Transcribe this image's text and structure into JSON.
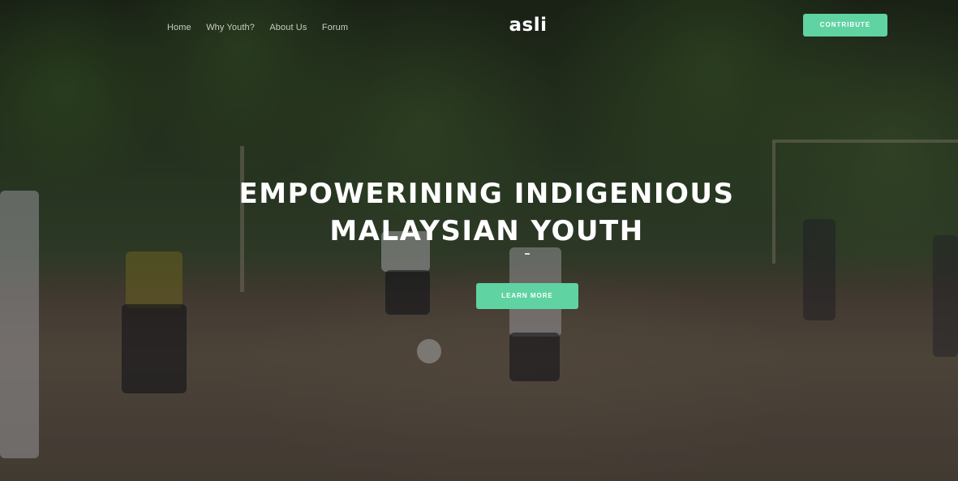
{
  "nav": {
    "items": [
      {
        "label": "Home"
      },
      {
        "label": "Why Youth?"
      },
      {
        "label": "About Us"
      },
      {
        "label": "Forum"
      }
    ]
  },
  "brand": {
    "logo_text": "asli"
  },
  "header": {
    "contribute_label": "CONTRIBUTE"
  },
  "hero": {
    "headline_line1": "EMPOWERINING INDIGENIOUS",
    "headline_line2": "MALAYSIAN YOUTH",
    "cta_label": "LEARN MORE",
    "background_image": "children playing football on a dirt field"
  },
  "colors": {
    "accent": "#5fd3a2",
    "text_light": "#ffffff",
    "nav_text": "#c9ccc4"
  }
}
